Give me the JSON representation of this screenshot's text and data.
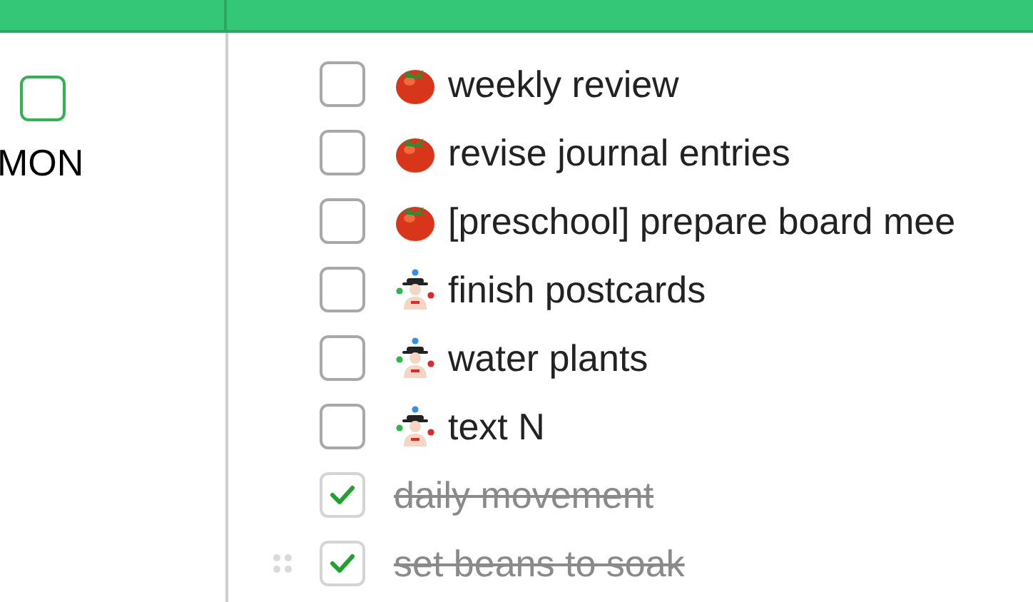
{
  "day": {
    "label": "MON",
    "checked": false
  },
  "tasks": [
    {
      "text": "weekly review",
      "checked": false,
      "kind": "tomato",
      "drag_handle": false
    },
    {
      "text": "revise journal entries",
      "checked": false,
      "kind": "tomato",
      "drag_handle": false
    },
    {
      "text": "[preschool] prepare board mee",
      "checked": false,
      "kind": "tomato",
      "drag_handle": false
    },
    {
      "text": "finish postcards",
      "checked": false,
      "kind": "juggler",
      "drag_handle": false
    },
    {
      "text": "water plants",
      "checked": false,
      "kind": "juggler",
      "drag_handle": false
    },
    {
      "text": "text N",
      "checked": false,
      "kind": "juggler",
      "drag_handle": false
    },
    {
      "text": "daily movement",
      "checked": true,
      "kind": "plain",
      "drag_handle": false
    },
    {
      "text": "set beans to soak",
      "checked": true,
      "kind": "plain",
      "drag_handle": true
    }
  ]
}
